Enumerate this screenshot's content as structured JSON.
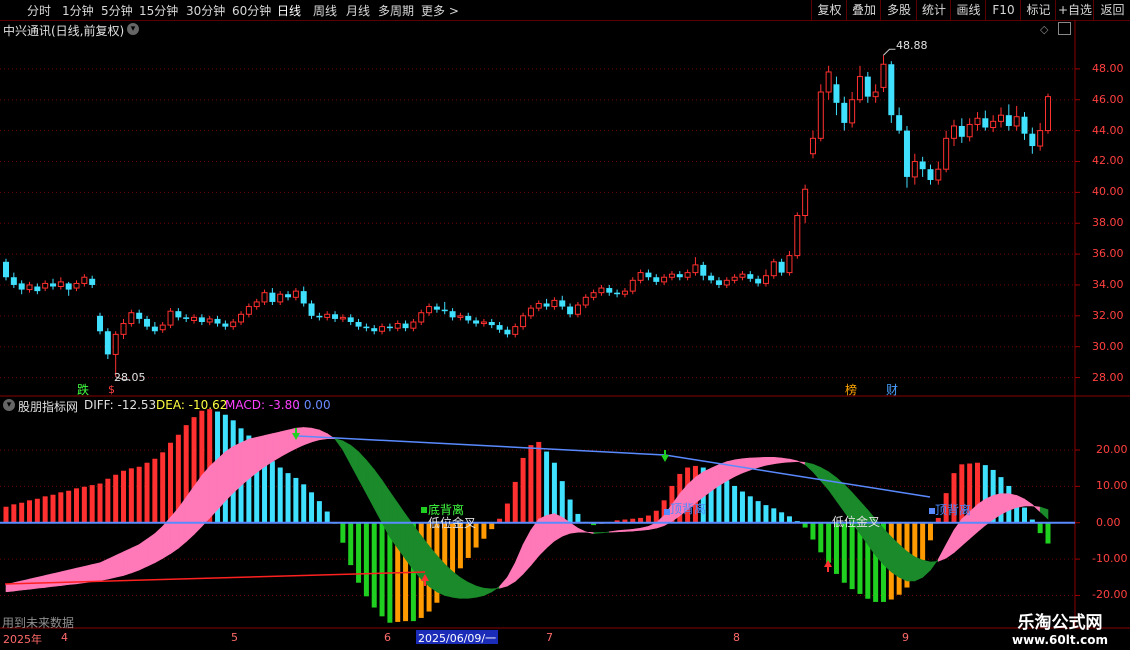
{
  "toolbar": {
    "periods": [
      "分时",
      "1分钟",
      "5分钟",
      "15分钟",
      "30分钟",
      "60分钟",
      "日线",
      "周线",
      "月线",
      "多周期",
      "更多 >"
    ],
    "selected": "日线",
    "right": [
      "复权",
      "叠加",
      "多股",
      "统计",
      "画线",
      "F10",
      "标记",
      "+自选",
      "返回"
    ]
  },
  "main": {
    "title": "中兴通讯(日线,前复权)",
    "high_label": "48.88",
    "low_label": "28.05",
    "markers": [
      {
        "text": "跌",
        "color": "#40ff40"
      },
      {
        "text": "$",
        "color": "#ff4040"
      },
      {
        "text": "榜",
        "color": "#ffa500"
      },
      {
        "text": "财",
        "color": "#4aa0ff"
      }
    ],
    "axis": [
      "48.00",
      "46.00",
      "44.00",
      "42.00",
      "40.00",
      "38.00",
      "36.00",
      "34.00",
      "32.00",
      "30.00",
      "28.00"
    ]
  },
  "indicator": {
    "name": "股朋指标网",
    "diff": "DIFF: -12.53",
    "dea": "DEA: -10.62",
    "macd": "MACD: -3.80",
    "extra": ": 0.00",
    "axis": [
      "20.00",
      "10.00",
      "0.00",
      "-10.00",
      "-20.00"
    ],
    "annotations": [
      "底背离",
      "低位金叉",
      "顶背离",
      "低位金叉",
      "顶背离"
    ],
    "footer_note": "用到未来数据"
  },
  "timeline": {
    "year": "2025年",
    "months": [
      "4",
      "5",
      "6",
      "7",
      "8",
      "9"
    ],
    "cursor_date": "2025/06/09/一"
  },
  "watermark": {
    "line1": "乐淘公式网",
    "line2": "www.60lt.com"
  },
  "colors": {
    "up": "#ff3030",
    "down": "#40e0ff",
    "green": "#20d020",
    "orange": "#ff9a00",
    "pink": "#ff78b8",
    "dgreen": "#1a8a2a",
    "blue": "#5a8aff"
  },
  "chart_data": {
    "type": "candlestick",
    "ylim": [
      27,
      50
    ],
    "candles": [
      [
        35.5,
        34.5,
        35.7,
        34.3
      ],
      [
        34.5,
        34.0,
        34.8,
        33.8
      ],
      [
        34.1,
        33.7,
        34.3,
        33.4
      ],
      [
        33.7,
        34.0,
        34.2,
        33.5
      ],
      [
        33.9,
        33.6,
        34.1,
        33.4
      ],
      [
        33.8,
        34.1,
        34.3,
        33.6
      ],
      [
        34.1,
        33.9,
        34.4,
        33.7
      ],
      [
        33.9,
        34.2,
        34.5,
        33.7
      ],
      [
        34.1,
        33.7,
        34.2,
        33.3
      ],
      [
        33.8,
        34.1,
        34.3,
        33.6
      ],
      [
        34.1,
        34.5,
        34.7,
        33.9
      ],
      [
        34.4,
        34.0,
        34.6,
        33.8
      ],
      [
        32.0,
        31.0,
        32.2,
        30.8
      ],
      [
        31.0,
        29.5,
        31.2,
        29.2
      ],
      [
        29.5,
        30.8,
        31.0,
        28.05
      ],
      [
        30.8,
        31.5,
        31.8,
        30.5
      ],
      [
        31.5,
        32.2,
        32.4,
        31.3
      ],
      [
        32.2,
        31.8,
        32.4,
        31.5
      ],
      [
        31.8,
        31.3,
        32.0,
        31.1
      ],
      [
        31.3,
        31.0,
        31.6,
        30.8
      ],
      [
        31.1,
        31.4,
        31.6,
        30.9
      ],
      [
        31.4,
        32.3,
        32.5,
        31.2
      ],
      [
        32.3,
        31.9,
        32.5,
        31.7
      ],
      [
        31.9,
        31.8,
        32.1,
        31.6
      ],
      [
        31.7,
        31.9,
        32.1,
        31.5
      ],
      [
        31.9,
        31.6,
        32.1,
        31.4
      ],
      [
        31.6,
        31.8,
        32.0,
        31.4
      ],
      [
        31.8,
        31.5,
        32.0,
        31.3
      ],
      [
        31.5,
        31.3,
        31.7,
        31.1
      ],
      [
        31.3,
        31.6,
        31.8,
        31.1
      ],
      [
        31.6,
        32.1,
        32.3,
        31.4
      ],
      [
        32.1,
        32.6,
        32.8,
        31.9
      ],
      [
        32.6,
        32.9,
        33.1,
        32.4
      ],
      [
        32.9,
        33.5,
        33.7,
        32.7
      ],
      [
        33.5,
        32.9,
        33.8,
        32.7
      ],
      [
        32.9,
        33.4,
        33.6,
        32.7
      ],
      [
        33.4,
        33.2,
        33.6,
        33.0
      ],
      [
        33.2,
        33.6,
        33.8,
        33.0
      ],
      [
        33.6,
        32.8,
        33.9,
        32.6
      ],
      [
        32.8,
        32.0,
        33.0,
        31.8
      ],
      [
        32.0,
        31.9,
        32.2,
        31.7
      ],
      [
        31.9,
        32.1,
        32.3,
        31.7
      ],
      [
        32.1,
        31.8,
        32.3,
        31.6
      ],
      [
        31.8,
        31.9,
        32.1,
        31.6
      ],
      [
        31.9,
        31.6,
        32.1,
        31.4
      ],
      [
        31.6,
        31.3,
        31.8,
        31.1
      ],
      [
        31.3,
        31.2,
        31.5,
        31.0
      ],
      [
        31.2,
        31.0,
        31.4,
        30.8
      ],
      [
        31.0,
        31.3,
        31.5,
        30.8
      ],
      [
        31.3,
        31.2,
        31.5,
        31.0
      ],
      [
        31.2,
        31.5,
        31.7,
        31.0
      ],
      [
        31.5,
        31.2,
        31.7,
        31.0
      ],
      [
        31.2,
        31.6,
        31.8,
        31.0
      ],
      [
        31.6,
        32.2,
        32.4,
        31.4
      ],
      [
        32.2,
        32.6,
        32.8,
        32.0
      ],
      [
        32.6,
        32.4,
        32.8,
        32.2
      ],
      [
        32.4,
        32.3,
        32.9,
        32.1
      ],
      [
        32.3,
        31.9,
        32.5,
        31.7
      ],
      [
        31.9,
        32.0,
        32.2,
        31.7
      ],
      [
        32.0,
        31.7,
        32.2,
        31.5
      ],
      [
        31.7,
        31.5,
        31.9,
        31.3
      ],
      [
        31.5,
        31.6,
        31.8,
        31.3
      ],
      [
        31.6,
        31.4,
        31.8,
        31.2
      ],
      [
        31.4,
        31.1,
        31.6,
        30.9
      ],
      [
        31.1,
        30.8,
        31.3,
        30.6
      ],
      [
        30.8,
        31.3,
        31.5,
        30.6
      ],
      [
        31.3,
        32.0,
        32.2,
        31.1
      ],
      [
        32.0,
        32.5,
        32.7,
        31.8
      ],
      [
        32.5,
        32.8,
        33.0,
        32.3
      ],
      [
        32.8,
        32.6,
        33.1,
        32.4
      ],
      [
        32.6,
        33.0,
        33.2,
        32.4
      ],
      [
        33.0,
        32.6,
        33.3,
        32.4
      ],
      [
        32.6,
        32.1,
        32.8,
        31.9
      ],
      [
        32.1,
        32.7,
        32.9,
        31.9
      ],
      [
        32.7,
        33.2,
        33.4,
        32.5
      ],
      [
        33.2,
        33.5,
        33.7,
        33.0
      ],
      [
        33.5,
        33.8,
        34.0,
        33.3
      ],
      [
        33.8,
        33.5,
        34.0,
        33.3
      ],
      [
        33.5,
        33.4,
        33.7,
        33.2
      ],
      [
        33.4,
        33.6,
        33.8,
        33.2
      ],
      [
        33.6,
        34.3,
        34.5,
        33.4
      ],
      [
        34.3,
        34.8,
        35.0,
        34.1
      ],
      [
        34.8,
        34.5,
        35.0,
        34.3
      ],
      [
        34.5,
        34.2,
        34.7,
        34.0
      ],
      [
        34.2,
        34.5,
        34.7,
        34.0
      ],
      [
        34.5,
        34.7,
        34.9,
        34.3
      ],
      [
        34.7,
        34.5,
        34.9,
        34.3
      ],
      [
        34.5,
        34.8,
        35.0,
        34.3
      ],
      [
        34.8,
        35.3,
        35.8,
        34.6
      ],
      [
        35.3,
        34.6,
        35.5,
        34.3
      ],
      [
        34.6,
        34.3,
        34.8,
        34.1
      ],
      [
        34.3,
        34.0,
        34.5,
        33.8
      ],
      [
        34.0,
        34.3,
        34.5,
        33.8
      ],
      [
        34.3,
        34.5,
        34.7,
        34.1
      ],
      [
        34.5,
        34.7,
        34.9,
        34.3
      ],
      [
        34.7,
        34.4,
        34.9,
        34.2
      ],
      [
        34.4,
        34.1,
        34.6,
        33.9
      ],
      [
        34.1,
        34.6,
        35.0,
        33.9
      ],
      [
        34.6,
        35.5,
        35.7,
        34.4
      ],
      [
        35.5,
        34.8,
        35.7,
        34.6
      ],
      [
        34.8,
        35.9,
        36.2,
        34.6
      ],
      [
        35.9,
        38.5,
        38.7,
        35.7
      ],
      [
        38.5,
        40.2,
        40.5,
        38.0
      ],
      [
        42.5,
        43.5,
        44.0,
        42.2
      ],
      [
        43.5,
        46.5,
        47.0,
        43.3
      ],
      [
        46.5,
        47.8,
        48.2,
        46.0
      ],
      [
        47.0,
        45.8,
        47.5,
        45.0
      ],
      [
        45.8,
        44.5,
        46.2,
        44.0
      ],
      [
        44.5,
        46.0,
        46.5,
        44.2
      ],
      [
        46.0,
        47.5,
        48.2,
        45.8
      ],
      [
        47.5,
        46.2,
        47.8,
        45.8
      ],
      [
        46.2,
        46.5,
        47.0,
        45.8
      ],
      [
        46.8,
        48.3,
        48.88,
        46.5
      ],
      [
        48.3,
        45.0,
        48.5,
        44.5
      ],
      [
        45.0,
        44.0,
        45.5,
        43.8
      ],
      [
        44.0,
        41.0,
        44.3,
        40.3
      ],
      [
        41.0,
        42.0,
        42.5,
        40.5
      ],
      [
        42.0,
        41.5,
        42.3,
        41.0
      ],
      [
        41.5,
        40.8,
        41.8,
        40.5
      ],
      [
        40.8,
        41.5,
        42.0,
        40.5
      ],
      [
        41.5,
        43.5,
        44.0,
        41.3
      ],
      [
        43.5,
        44.3,
        44.7,
        43.0
      ],
      [
        44.3,
        43.6,
        44.8,
        43.2
      ],
      [
        43.6,
        44.4,
        44.8,
        43.3
      ],
      [
        44.4,
        44.8,
        45.2,
        44.0
      ],
      [
        44.8,
        44.2,
        45.3,
        44.0
      ],
      [
        44.2,
        44.6,
        45.0,
        43.9
      ],
      [
        44.6,
        45.0,
        45.5,
        44.2
      ],
      [
        45.0,
        44.3,
        45.7,
        44.0
      ],
      [
        44.3,
        44.9,
        45.6,
        44.0
      ],
      [
        44.9,
        43.8,
        45.2,
        43.4
      ],
      [
        43.8,
        43.0,
        44.2,
        42.5
      ],
      [
        43.0,
        44.0,
        44.5,
        42.7
      ],
      [
        44.0,
        46.2,
        46.4,
        43.8
      ]
    ],
    "diff": [
      -17,
      -16.5,
      -16,
      -15.5,
      -15,
      -14.5,
      -14,
      -13.5,
      -13,
      -12.5,
      -12,
      -11.5,
      -11,
      -10,
      -9,
      -8,
      -7,
      -6,
      -4.5,
      -3,
      -1,
      1.5,
      4,
      7,
      10,
      13,
      15.5,
      17.5,
      19.5,
      21,
      22,
      23,
      23.5,
      24,
      24.5,
      25,
      25.5,
      26,
      26.2,
      26,
      25.5,
      24.5,
      23,
      20,
      16,
      12,
      8,
      4,
      0,
      -4,
      -7,
      -10,
      -13,
      -15.5,
      -17.5,
      -19,
      -20,
      -20.5,
      -20.8,
      -20.8,
      -20.5,
      -20,
      -19,
      -17.5,
      -15,
      -11,
      -6,
      -2,
      1,
      2,
      2.5,
      1.5,
      0,
      -1.5,
      -2.5,
      -3,
      -2.8,
      -2.5,
      -2.2,
      -2,
      -1.8,
      -1.5,
      -1,
      0,
      2,
      5,
      8,
      10.5,
      12.5,
      14,
      15,
      16,
      16.8,
      17.3,
      17.6,
      17.8,
      17.9,
      18,
      18,
      17.8,
      17.5,
      17,
      16,
      14,
      11.5,
      9,
      6,
      3,
      0,
      -3,
      -6,
      -9,
      -11.5,
      -13.5,
      -15,
      -16,
      -16,
      -15,
      -13,
      -10,
      -6,
      -2,
      1,
      3,
      5,
      6.5,
      7.5,
      8,
      8,
      7.5,
      6.5,
      5,
      3,
      1,
      -1,
      -3,
      -5,
      -7,
      -9,
      -10.5,
      -11.5,
      -12,
      -12.3,
      -12.53
    ],
    "dea": [
      -19,
      -18.8,
      -18.5,
      -18.3,
      -18,
      -17.8,
      -17.5,
      -17.3,
      -17,
      -16.8,
      -16.5,
      -16.2,
      -15.9,
      -15.5,
      -15,
      -14.5,
      -13.8,
      -13,
      -12,
      -11,
      -9.8,
      -8.5,
      -7,
      -5.2,
      -3.2,
      -1,
      1.3,
      3.6,
      6,
      8.2,
      10.2,
      12.1,
      13.8,
      15.4,
      16.8,
      18.1,
      19.3,
      20.4,
      21.4,
      22.2,
      22.8,
      23.1,
      23.1,
      22.5,
      21.3,
      19.5,
      17.2,
      14.6,
      11.7,
      8.5,
      5.4,
      2.3,
      -0.7,
      -3.6,
      -6.4,
      -9,
      -11.4,
      -13.4,
      -15.1,
      -16.4,
      -17.4,
      -18,
      -18.2,
      -18,
      -17.4,
      -16.1,
      -14.1,
      -11.7,
      -9.1,
      -6.9,
      -5,
      -3.7,
      -2.9,
      -2.6,
      -2.6,
      -2.7,
      -2.7,
      -2.6,
      -2.5,
      -2.4,
      -2.3,
      -2.1,
      -1.9,
      -1.5,
      -0.8,
      0.4,
      1.9,
      3.6,
      5.4,
      7.1,
      8.7,
      10.2,
      11.5,
      12.7,
      13.7,
      14.5,
      15.2,
      15.8,
      16.2,
      16.5,
      16.7,
      16.8,
      16.6,
      16.1,
      15.2,
      14,
      12.4,
      10.5,
      8.3,
      5.9,
      3.5,
      0.9,
      -1.6,
      -3.9,
      -6,
      -7.9,
      -9.4,
      -10.3,
      -10.8,
      -10.6,
      -9.7,
      -8.2,
      -6.3,
      -4.4,
      -2.5,
      -0.7,
      0.9,
      2.3,
      3.4,
      4.2,
      4.6,
      4.6,
      4.3,
      3.6,
      2.7,
      1.5,
      0.2,
      -1.2,
      -2.7,
      -4.2,
      -5.6,
      -7,
      -8.4,
      -10.62
    ]
  }
}
